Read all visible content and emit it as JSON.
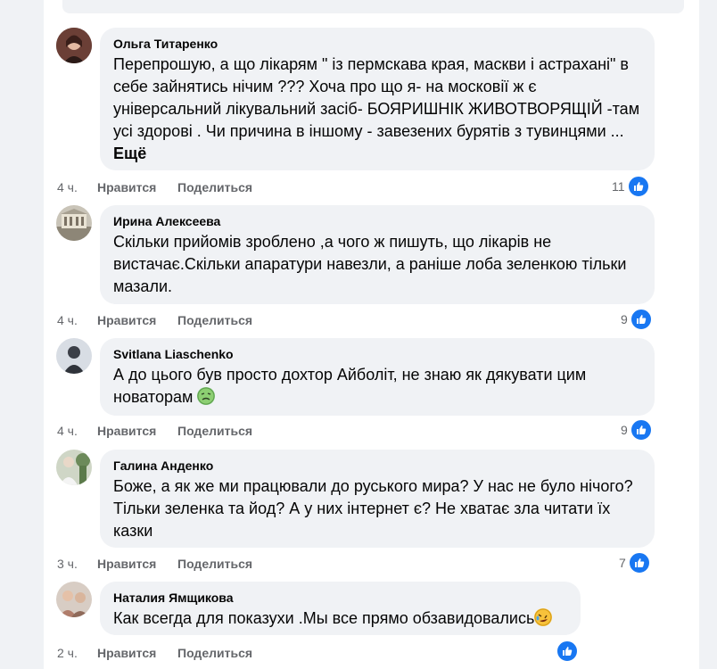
{
  "actions": {
    "like_label": "Нравится",
    "share_label": "Поделиться",
    "more_label": "Ещё"
  },
  "comments": [
    {
      "author": "Ольга Титаренко",
      "text": "Перепрошую, а що лікарям \" із пермскава края, маскви і астрахані\" в себе зайнятись нічим ??? Хоча про що я- на московії ж є універсальний лікувальний засіб- БОЯРИШНІК ЖИВОТВОРЯЩІЙ -там усі здорові . Чи причина в іншому - завезених бурятів з тувинцями ...",
      "time": "4 ч.",
      "likes": "11"
    },
    {
      "author": "Ирина Алексеева",
      "text": "Скільки прийомів зроблено ,а чого ж пишуть, що лікарів не вистачає.Скільки апаратури навезли, а раніше лоба зеленкою тільки мазали.",
      "time": "4 ч.",
      "likes": "9"
    },
    {
      "author": "Svitlana Liaschenko",
      "text": "А до цього був просто дохтор Айболіт, не знаю як дякувати цим новаторам",
      "time": "4 ч.",
      "likes": "9"
    },
    {
      "author": "Галина Анденко",
      "text": "Боже, а як же ми працювали до руського мира? У нас не було нічого? Тільки зеленка та йод? А у них інтернет є? Не хватає зла читати їх казки",
      "time": "3 ч.",
      "likes": "7"
    },
    {
      "author": "Наталия Ямщикова",
      "text": "Как всегда для показухи .Мы все прямо обзавидовались",
      "time": "2 ч.",
      "likes": ""
    }
  ],
  "colors": {
    "bubble": "#f0f2f5",
    "meta": "#65676b",
    "like": "#1877f2",
    "text": "#050505"
  }
}
